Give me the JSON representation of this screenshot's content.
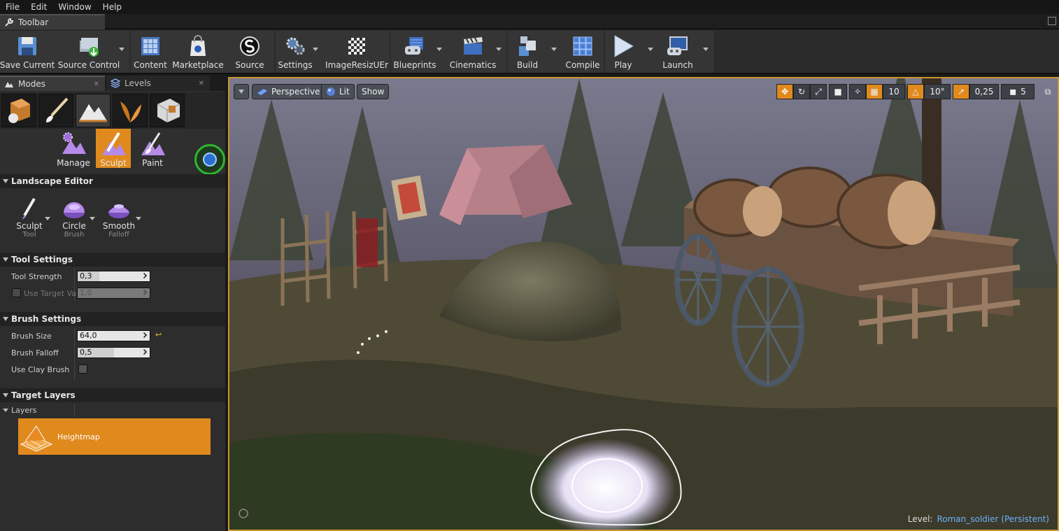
{
  "menu": {
    "items": [
      "File",
      "Edit",
      "Window",
      "Help"
    ]
  },
  "toolbar_tab": {
    "label": "Toolbar"
  },
  "toolbar": {
    "buttons": [
      {
        "label": "Save Current"
      },
      {
        "label": "Source Control"
      },
      {
        "label": "Content"
      },
      {
        "label": "Marketplace"
      },
      {
        "label": "Source"
      },
      {
        "label": "Settings"
      },
      {
        "label": "ImageResizUEr"
      },
      {
        "label": "Blueprints"
      },
      {
        "label": "Cinematics"
      },
      {
        "label": "Build"
      },
      {
        "label": "Compile"
      },
      {
        "label": "Play"
      },
      {
        "label": "Launch"
      }
    ]
  },
  "panel_tabs": {
    "modes": "Modes",
    "levels": "Levels"
  },
  "landscape_modes": {
    "manage": "Manage",
    "sculpt": "Sculpt",
    "paint": "Paint"
  },
  "sections": {
    "landscape_editor": "Landscape Editor",
    "tool_settings": "Tool Settings",
    "brush_settings": "Brush Settings",
    "target_layers": "Target Layers"
  },
  "tool_selectors": [
    {
      "label": "Sculpt",
      "sub": "Tool"
    },
    {
      "label": "Circle",
      "sub": "Brush"
    },
    {
      "label": "Smooth",
      "sub": "Falloff"
    }
  ],
  "tool_settings": {
    "tool_strength_label": "Tool Strength",
    "tool_strength_value": "0,3",
    "use_target_label": "Use Target Va",
    "use_target_value": "1,0"
  },
  "brush_settings": {
    "brush_size_label": "Brush Size",
    "brush_size_value": "64,0",
    "brush_falloff_label": "Brush Falloff",
    "brush_falloff_value": "0,5",
    "use_clay_label": "Use Clay Brush"
  },
  "target_layers": {
    "layers_label": "Layers",
    "layer_name": "Heightmap"
  },
  "viewport": {
    "perspective": "Perspective",
    "lit": "Lit",
    "show": "Show",
    "grid_snap": "10",
    "rot_snap": "10°",
    "scale_snap": "0,25",
    "cam_speed": "5",
    "level_label": "Level:",
    "level_name": "Roman_soldier (Persistent)"
  },
  "colors": {
    "accent": "#e08a1e",
    "viewport_border": "#c8962c",
    "level_link": "#6ab0ff"
  }
}
